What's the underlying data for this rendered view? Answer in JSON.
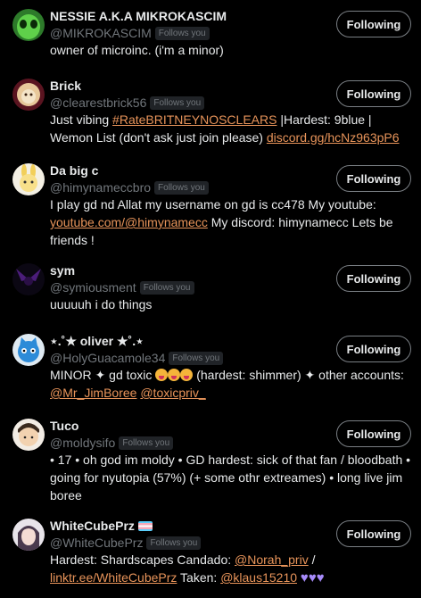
{
  "follow_button_label": "Following",
  "follows_you_badge": "Follows you",
  "accounts": [
    {
      "name": "NESSIE A.K.A MIKROKASCIM",
      "handle": "@MIKROKASCIM",
      "bio": [
        "owner of microinc. (i'm a minor)"
      ]
    },
    {
      "name": "Brick",
      "handle": "@clearestbrick56",
      "bio_parts": [
        "Just vibing ",
        "#RateBRITNEYNOSCLEARS",
        " |Hardest: 9blue | Wemon List (don't ask just join please) ",
        "discord.gg/hcNz963pP6"
      ]
    },
    {
      "name": "Da big c",
      "handle": "@himynameccbro",
      "bio_parts": [
        "I play gd nd Allat my username on gd is cc478 My youtube: ",
        "youtube.com/@himynamecc",
        " My discord: himynamecc Lets be friends !"
      ]
    },
    {
      "name": "sym",
      "handle": "@symiousment",
      "bio": [
        "uuuuuh i do things"
      ]
    },
    {
      "name": "⋆.˚★ oliver ★˚.⋆",
      "handle": "@HolyGuacamole34",
      "bio_parts": [
        "MINOR ✦ gd toxic ",
        "(hardest: shimmer) ✦ other accounts: ",
        "@Mr_JimBoree",
        "@toxicpriv_"
      ]
    },
    {
      "name": "Tuco",
      "handle": "@moldysifo",
      "bio": [
        "• 17 • oh god im moldy • GD hardest: sick of that fan / bloodbath • going for nyutopia (57%) (+ some othr extreames) • long live jim boree"
      ]
    },
    {
      "name": "WhiteCubePrz",
      "handle": "@WhiteCubePrz",
      "bio_parts": [
        "Hardest: Shardscapes Candado: ",
        "@Norah_priv",
        " / ",
        "linktr.ee/WhiteCubePrz",
        " Taken: ",
        "@klaus15210"
      ]
    }
  ],
  "colors": {
    "background": "#000000",
    "text": "#e7e9ea",
    "muted": "#71767b",
    "link": "#e8945a"
  },
  "icons": [
    "green-alien-avatar-icon",
    "lion-avatar-icon",
    "bunny-avatar-icon",
    "dark-wings-avatar-icon",
    "cat-avatar-icon",
    "boy-avatar-icon",
    "anime-girl-avatar-icon",
    "trans-flag-icon",
    "purple-heart-icon",
    "face-emoji-icon"
  ]
}
